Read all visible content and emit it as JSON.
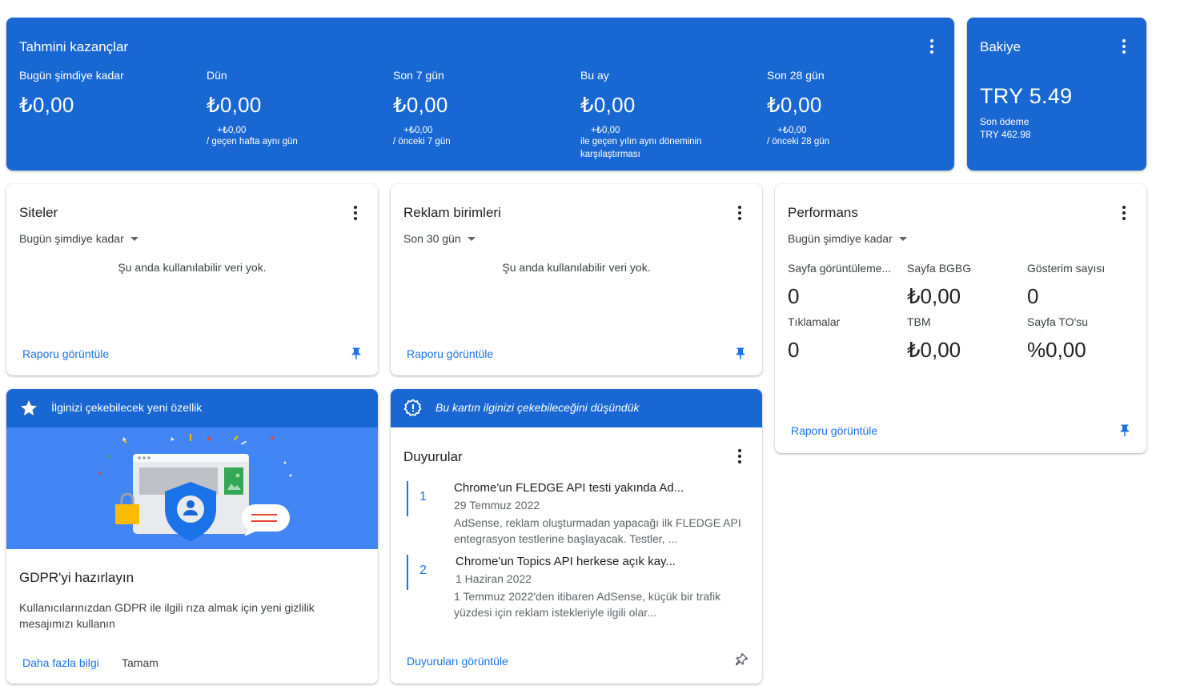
{
  "colors": {
    "primary_blue": "#1967d2",
    "link_blue": "#1a73e8",
    "illustration_blue": "#4285f4"
  },
  "earnings": {
    "title": "Tahmini kazançlar",
    "columns": [
      {
        "label": "Bugün şimdiye kadar",
        "value": "₺0,00",
        "change": "",
        "compare": ""
      },
      {
        "label": "Dün",
        "value": "₺0,00",
        "change": "+₺0,00",
        "compare": "/ geçen hafta aynı gün"
      },
      {
        "label": "Son 7 gün",
        "value": "₺0,00",
        "change": "+₺0,00",
        "compare": "/ önceki 7 gün"
      },
      {
        "label": "Bu ay",
        "value": "₺0,00",
        "change": "+₺0,00",
        "compare": "ile geçen yılın aynı döneminin karşılaştırması"
      },
      {
        "label": "Son 28 gün",
        "value": "₺0,00",
        "change": "+₺0,00",
        "compare": "/ önceki 28 gün"
      }
    ]
  },
  "balance": {
    "title": "Bakiye",
    "amount": "TRY 5.49",
    "last_payment_label": "Son ödeme",
    "last_payment_value": "TRY 462.98"
  },
  "sites": {
    "title": "Siteler",
    "range": "Bugün şimdiye kadar",
    "empty": "Şu anda kullanılabilir veri yok.",
    "link": "Raporu görüntüle"
  },
  "ad_units": {
    "title": "Reklam birimleri",
    "range": "Son 30 gün",
    "empty": "Şu anda kullanılabilir veri yok.",
    "link": "Raporu görüntüle"
  },
  "performance": {
    "title": "Performans",
    "range": "Bugün şimdiye kadar",
    "metrics": [
      {
        "label": "Sayfa görüntüleme...",
        "value": "0"
      },
      {
        "label": "Sayfa BGBG",
        "value": "₺0,00"
      },
      {
        "label": "Gösterim sayısı",
        "value": "0"
      },
      {
        "label": "Tıklamalar",
        "value": "0"
      },
      {
        "label": "TBM",
        "value": "₺0,00"
      },
      {
        "label": "Sayfa TO'su",
        "value": "%0,00"
      }
    ],
    "link": "Raporu görüntüle"
  },
  "feature": {
    "header": "İlginizi çekebilecek yeni özellik",
    "title": "GDPR'yi hazırlayın",
    "description": "Kullanıcılarınızdan GDPR ile ilgili rıza almak için yeni gizlilik mesajımızı kullanın",
    "learn_more": "Daha fazla bilgi",
    "dismiss": "Tamam"
  },
  "announcements": {
    "header": "Bu kartın ilginizi çekebileceğini düşündük",
    "title": "Duyurular",
    "items": [
      {
        "num": "1",
        "title": "Chrome'un FLEDGE API testi yakında Ad...",
        "date": "29 Temmuz 2022",
        "body": "AdSense, reklam oluşturmadan yapacağı ilk FLEDGE API entegrasyon testlerine başlayacak. Testler, ..."
      },
      {
        "num": "2",
        "title": "Chrome'un Topics API herkese açık kay...",
        "date": "1 Haziran 2022",
        "body": "1 Temmuz 2022'den itibaren AdSense, küçük bir trafik yüzdesi için reklam istekleriyle ilgili olar..."
      }
    ],
    "link": "Duyuruları görüntüle"
  }
}
